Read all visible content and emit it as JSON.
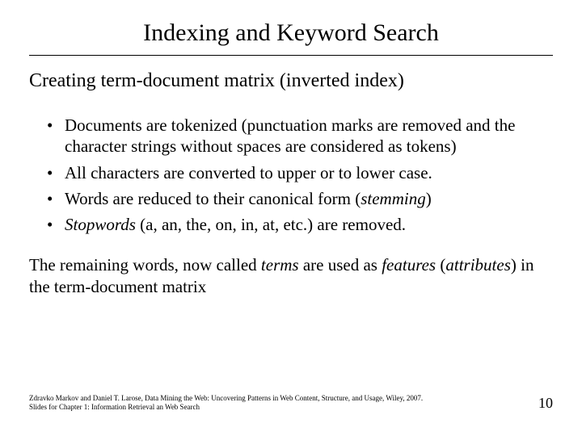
{
  "title": "Indexing and Keyword Search",
  "subtitle": "Creating term-document matrix (inverted index)",
  "bullets": {
    "b1_pre": "Documents are tokenized ",
    "b1_paren": "(punctuation marks are removed and the character strings without spaces are considered as tokens)",
    "b2": "All characters are converted to upper or to lower case.",
    "b3_pre": "Words are reduced to their canonical form (",
    "b3_it": "stemming",
    "b3_post": ")",
    "b4_it": "Stopwords",
    "b4_rest": " (a, an, the, on, in, at, etc.) are removed."
  },
  "closing": {
    "c1": "The remaining words, now called ",
    "c2_it": "terms",
    "c3": " are used as ",
    "c4_it": "features",
    "c5": " (",
    "c6_it": "attributes",
    "c7": ") in the term-document matrix"
  },
  "footer": {
    "line1": "Zdravko Markov and Daniel T. Larose, Data Mining the Web: Uncovering Patterns in Web Content, Structure, and Usage, Wiley, 2007.",
    "line2": "Slides for Chapter 1: Information Retrieval an Web Search",
    "pagenum": "10"
  }
}
